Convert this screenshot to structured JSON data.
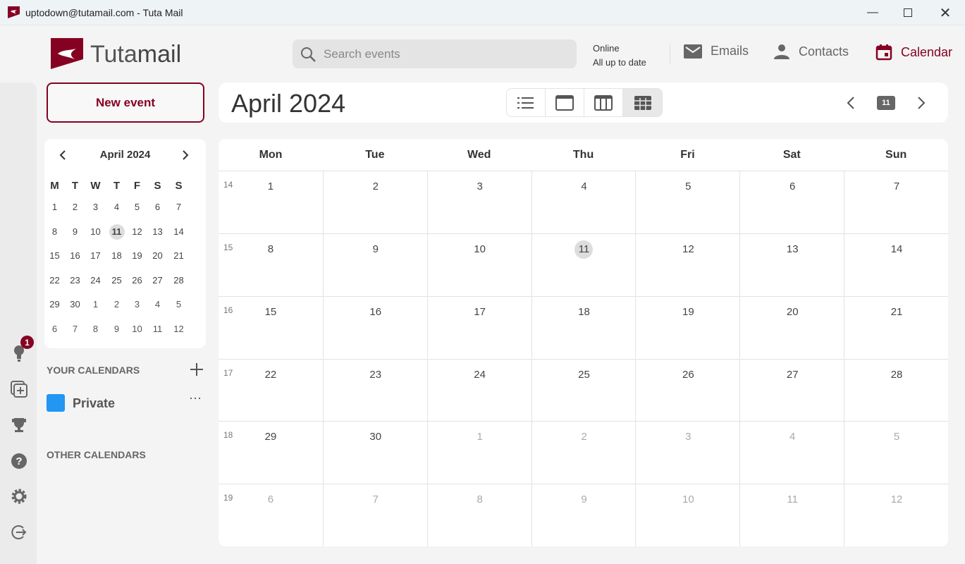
{
  "window": {
    "title": "uptodown@tutamail.com - Tuta Mail",
    "controls": [
      "minimize",
      "maximize",
      "close"
    ]
  },
  "logo": {
    "text_light": "Tuta",
    "text_bold": "mail"
  },
  "search": {
    "placeholder": "Search events",
    "value": ""
  },
  "status": {
    "line1": "Online",
    "line2": "All up to date"
  },
  "nav": [
    {
      "label": "Emails",
      "icon": "mail-icon",
      "active": false
    },
    {
      "label": "Contacts",
      "icon": "person-icon",
      "active": false
    },
    {
      "label": "Calendar",
      "icon": "calendar-icon",
      "active": true
    }
  ],
  "new_event_label": "New event",
  "header": {
    "title": "April 2024",
    "views": [
      "agenda",
      "day",
      "week",
      "month"
    ],
    "active_view": "month",
    "today_label": "11"
  },
  "mini": {
    "title": "April 2024",
    "weekdays": [
      "M",
      "T",
      "W",
      "T",
      "F",
      "S",
      "S"
    ],
    "weeks": [
      [
        1,
        2,
        3,
        4,
        5,
        6,
        7
      ],
      [
        8,
        9,
        10,
        11,
        12,
        13,
        14
      ],
      [
        15,
        16,
        17,
        18,
        19,
        20,
        21
      ],
      [
        22,
        23,
        24,
        25,
        26,
        27,
        28
      ],
      [
        29,
        30,
        1,
        2,
        3,
        4,
        5
      ],
      [
        6,
        7,
        8,
        9,
        10,
        11,
        12
      ]
    ],
    "today": 11
  },
  "sidebar": {
    "your_calendars": "YOUR CALENDARS",
    "calendars": [
      {
        "name": "Private",
        "color": "#2196f3"
      }
    ],
    "other_calendars": "OTHER CALENDARS",
    "notification_count": "1"
  },
  "month": {
    "weekdays": [
      "Mon",
      "Tue",
      "Wed",
      "Thu",
      "Fri",
      "Sat",
      "Sun"
    ],
    "week_numbers": [
      "14",
      "15",
      "16",
      "17",
      "18",
      "19"
    ],
    "weeks": [
      [
        1,
        2,
        3,
        4,
        5,
        6,
        7
      ],
      [
        8,
        9,
        10,
        11,
        12,
        13,
        14
      ],
      [
        15,
        16,
        17,
        18,
        19,
        20,
        21
      ],
      [
        22,
        23,
        24,
        25,
        26,
        27,
        28
      ],
      [
        29,
        30,
        1,
        2,
        3,
        4,
        5
      ],
      [
        6,
        7,
        8,
        9,
        10,
        11,
        12
      ]
    ],
    "today": 11
  },
  "colors": {
    "accent": "#850122",
    "private": "#2196f3"
  }
}
